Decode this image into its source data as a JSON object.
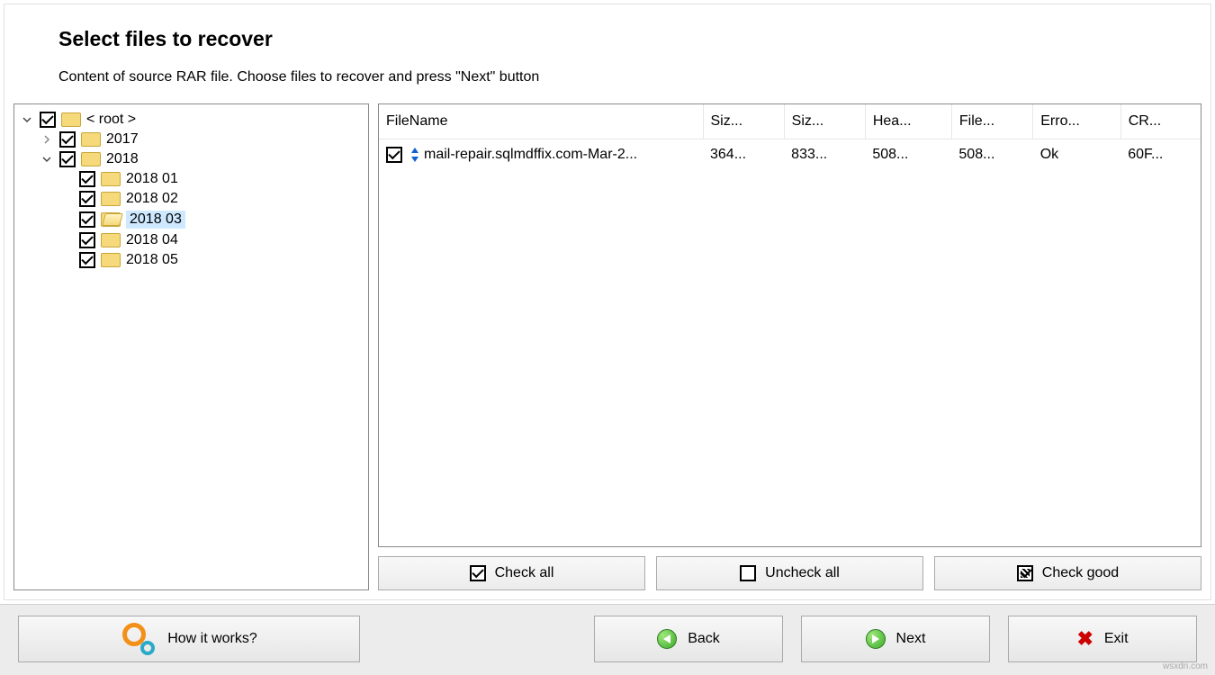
{
  "page": {
    "title": "Select files to recover",
    "subtitle": "Content of source RAR file. Choose files to recover and press \"Next\" button"
  },
  "tree": {
    "root": {
      "label": "< root >",
      "expanded": true,
      "checked": true
    },
    "y2017": {
      "label": "2017",
      "expanded": false,
      "checked": true
    },
    "y2018": {
      "label": "2018",
      "expanded": true,
      "checked": true
    },
    "m01": {
      "label": "2018 01",
      "checked": true
    },
    "m02": {
      "label": "2018 02",
      "checked": true
    },
    "m03": {
      "label": "2018 03",
      "checked": true,
      "selected": true
    },
    "m04": {
      "label": "2018 04",
      "checked": true
    },
    "m05": {
      "label": "2018 05",
      "checked": true
    }
  },
  "columns": {
    "c0": "FileName",
    "c1": "Siz...",
    "c2": "Siz...",
    "c3": "Hea...",
    "c4": "File...",
    "c5": "Erro...",
    "c6": "CR..."
  },
  "rows": [
    {
      "checked": true,
      "filename": "mail-repair.sqlmdffix.com-Mar-2...",
      "c1": "364...",
      "c2": "833...",
      "c3": "508...",
      "c4": "508...",
      "c5": "Ok",
      "c6": "60F..."
    }
  ],
  "actions": {
    "check_all": "Check all",
    "uncheck_all": "Uncheck all",
    "check_good": "Check good"
  },
  "footer": {
    "how_it_works": "How it works?",
    "back": "Back",
    "next": "Next",
    "exit": "Exit"
  },
  "watermark": "wsxdn.com"
}
